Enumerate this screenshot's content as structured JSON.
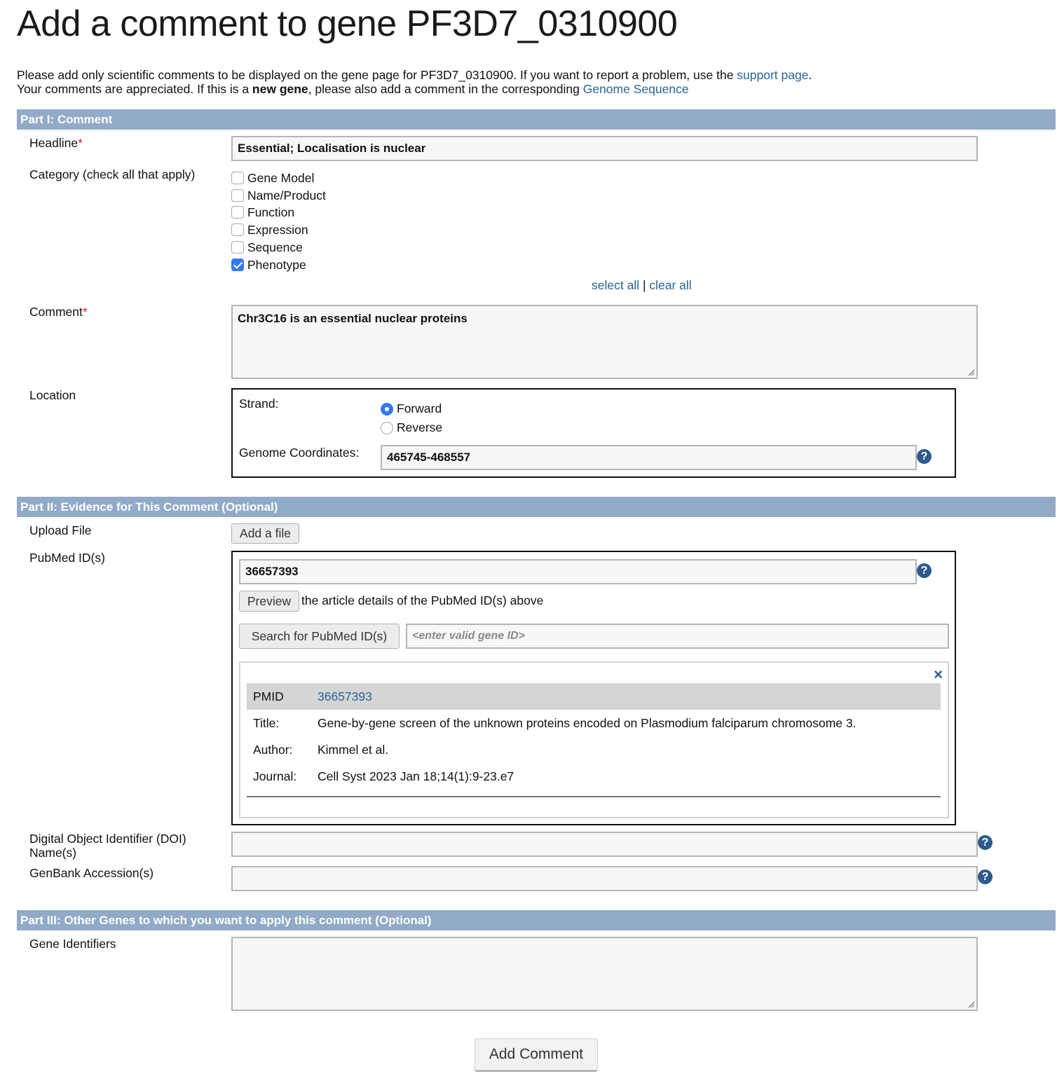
{
  "title": "Add a comment to gene PF3D7_0310900",
  "intro": {
    "line1_text": "Please add only scientific comments to be displayed on the gene page for PF3D7_0310900. If you want to report a problem, use the ",
    "support_link": "support page",
    "line1_end": ".",
    "line2_text": "Your comments are appreciated. If this is a ",
    "line2_bold": "new gene",
    "line2_mid": ", please also add a comment in the corresponding ",
    "genome_link": "Genome Sequence"
  },
  "part1": {
    "header": "Part I: Comment",
    "headline_label": "Headline",
    "required_mark": "*",
    "headline_value": "Essential; Localisation is nuclear",
    "category_label": "Category (check all that apply)",
    "categories": [
      {
        "label": "Gene Model",
        "checked": false
      },
      {
        "label": "Name/Product",
        "checked": false
      },
      {
        "label": "Function",
        "checked": false
      },
      {
        "label": "Expression",
        "checked": false
      },
      {
        "label": "Sequence",
        "checked": false
      },
      {
        "label": "Phenotype",
        "checked": true
      }
    ],
    "select_all": "select all",
    "separator": "|",
    "clear_all": "clear all",
    "comment_label": "Comment",
    "comment_value": "Chr3C16 is an essential nuclear proteins",
    "location_label": "Location",
    "strand_label": "Strand:",
    "strand_forward": "Forward",
    "strand_reverse": "Reverse",
    "coords_label": "Genome Coordinates:",
    "coords_value": "465745-468557"
  },
  "part2": {
    "header": "Part II: Evidence for This Comment (Optional)",
    "upload_label": "Upload File",
    "add_file_button": "Add a file",
    "pubmed_label": "PubMed ID(s)",
    "pubmed_value": "36657393",
    "preview_button": "Preview",
    "preview_text": "the article details of the PubMed ID(s) above",
    "search_button": "Search for PubMed ID(s)",
    "search_placeholder": "<enter valid gene ID>",
    "article": {
      "pmid_key": "PMID",
      "pmid_value": "36657393",
      "title_key": "Title:",
      "title_value": "Gene-by-gene screen of the unknown proteins encoded on Plasmodium falciparum chromosome 3.",
      "author_key": "Author:",
      "author_value": "Kimmel et al.",
      "journal_key": "Journal:",
      "journal_value": "Cell Syst 2023 Jan 18;14(1):9-23.e7"
    },
    "doi_label_line1": "Digital Object Identifier (DOI)",
    "doi_label_line2": "Name(s)",
    "doi_value": "",
    "genbank_label": "GenBank Accession(s)",
    "genbank_value": ""
  },
  "part3": {
    "header": "Part III: Other Genes to which you want to apply this comment (Optional)",
    "gene_ids_label": "Gene Identifiers",
    "gene_ids_value": ""
  },
  "submit_button": "Add Comment",
  "icons": {
    "help": "?",
    "close": "×"
  },
  "colors": {
    "section_bar": "#91aac8",
    "link": "#2a6496",
    "help_icon": "#2c5a8c",
    "checked": "#3478f6",
    "required": "#d9261c"
  }
}
